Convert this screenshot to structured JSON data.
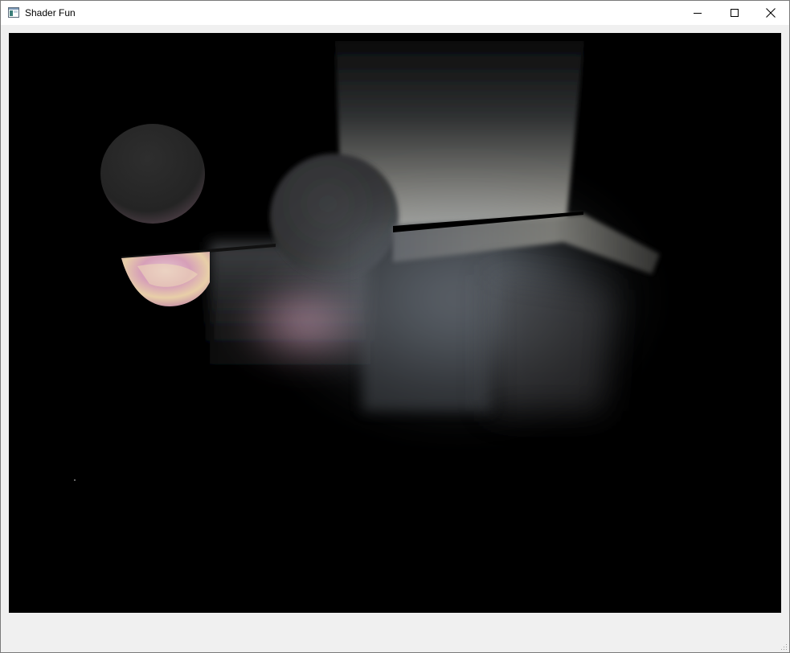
{
  "window": {
    "title": "Shader Fun",
    "icon": "app-window-icon",
    "controls": {
      "minimize": "minimize-icon",
      "maximize": "maximize-icon",
      "close": "close-icon"
    }
  },
  "scene": {
    "background": "#000000",
    "objects": [
      "planet-sphere",
      "gray-sphere",
      "textured-sphere",
      "cube",
      "pillar",
      "ledge"
    ]
  },
  "colors": {
    "titlebar": "#ffffff",
    "chrome": "#f0f0f0",
    "viewport": "#000000"
  }
}
